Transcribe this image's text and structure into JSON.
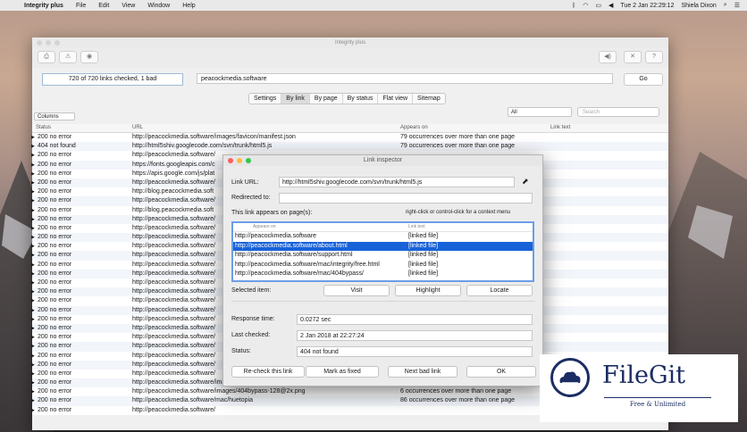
{
  "menubar": {
    "app_name": "Integrity plus",
    "items": [
      "File",
      "Edit",
      "View",
      "Window",
      "Help"
    ],
    "clock": "Tue 2 Jan  22:29:12",
    "user": "Shiela Dixon"
  },
  "window": {
    "title": "Integrity plus",
    "status": "720 of 720 links checked, 1 bad",
    "url": "peacockmedia.software",
    "go_label": "Go",
    "tabs": [
      "Settings",
      "By link",
      "By page",
      "By status",
      "Flat view",
      "Sitemap"
    ],
    "active_tab": "By link",
    "columns_select": "Columns",
    "filter_select": "All",
    "search_placeholder": "Search",
    "headers": {
      "status": "Status",
      "url": "URL",
      "appears": "Appears on",
      "linktext": "Link text"
    }
  },
  "rows": [
    {
      "status": "200 no error",
      "url": "http://peacockmedia.software/images/favicon/manifest.json",
      "appears": "79 occurrences over more than one page"
    },
    {
      "status": "404 not found",
      "url": "http://html5shiv.googlecode.com/svn/trunk/html5.js",
      "appears": "79 occurrences over more than one page"
    },
    {
      "status": "200 no error",
      "url": "http://peacockmedia.software/",
      "appears": ""
    },
    {
      "status": "200 no error",
      "url": "https://fonts.googleapis.com/c",
      "appears": ""
    },
    {
      "status": "200 no error",
      "url": "https://apis.google.com/js/plat",
      "appears": ""
    },
    {
      "status": "200 no error",
      "url": "http://peacockmedia.software/",
      "appears": ""
    },
    {
      "status": "200 no error",
      "url": "http://blog.peacockmedia.soft",
      "appears": ""
    },
    {
      "status": "200 no error",
      "url": "http://peacockmedia.software/",
      "appears": ""
    },
    {
      "status": "200 no error",
      "url": "http://blog.peacockmedia.soft",
      "appears": ""
    },
    {
      "status": "200 no error",
      "url": "http://peacockmedia.software/",
      "appears": ""
    },
    {
      "status": "200 no error",
      "url": "http://peacockmedia.software/",
      "appears": ""
    },
    {
      "status": "200 no error",
      "url": "http://peacockmedia.software/",
      "appears": ""
    },
    {
      "status": "200 no error",
      "url": "http://peacockmedia.software/",
      "appears": ""
    },
    {
      "status": "200 no error",
      "url": "http://peacockmedia.software/",
      "appears": ""
    },
    {
      "status": "200 no error",
      "url": "http://peacockmedia.software/",
      "appears": ""
    },
    {
      "status": "200 no error",
      "url": "http://peacockmedia.software/",
      "appears": ""
    },
    {
      "status": "200 no error",
      "url": "http://peacockmedia.software/",
      "appears": ""
    },
    {
      "status": "200 no error",
      "url": "http://peacockmedia.software/",
      "appears": ""
    },
    {
      "status": "200 no error",
      "url": "http://peacockmedia.software/",
      "appears": ""
    },
    {
      "status": "200 no error",
      "url": "http://peacockmedia.software/",
      "appears": ""
    },
    {
      "status": "200 no error",
      "url": "http://peacockmedia.software/",
      "appears": ""
    },
    {
      "status": "200 no error",
      "url": "http://peacockmedia.software/",
      "appears": ""
    },
    {
      "status": "200 no error",
      "url": "http://peacockmedia.software/",
      "appears": ""
    },
    {
      "status": "200 no error",
      "url": "http://peacockmedia.software/",
      "appears": ""
    },
    {
      "status": "200 no error",
      "url": "http://peacockmedia.software/",
      "appears": ""
    },
    {
      "status": "200 no error",
      "url": "http://peacockmedia.software/",
      "appears": ""
    },
    {
      "status": "200 no error",
      "url": "http://peacockmedia.software/",
      "appears": ""
    },
    {
      "status": "200 no error",
      "url": "http://peacockmedia.software/images/404bypass-128.png",
      "appears": "6 occurrences over more than one page"
    },
    {
      "status": "200 no error",
      "url": "http://peacockmedia.software/images/404bypass-128@2x.png",
      "appears": "6 occurrences over more than one page"
    },
    {
      "status": "200 no error",
      "url": "http://peacockmedia.software/mac/huetopia",
      "appears": "86 occurrences over more than one page"
    },
    {
      "status": "200 no error",
      "url": "http://peacockmedia.software/",
      "appears": ""
    }
  ],
  "inspector": {
    "title": "Link inspector",
    "link_url_label": "Link URL:",
    "link_url": "http://html5shiv.googlecode.com/svn/trunk/html5.js",
    "redirected_label": "Redirected to:",
    "redirected": "",
    "appears_label": "This link appears on page(s):",
    "hint": "right-click or control-click for a context menu",
    "list_headers": {
      "page": "Appears on",
      "text": "Link text"
    },
    "pages": [
      {
        "url": "http://peacockmedia.software",
        "text": "[linked file]"
      },
      {
        "url": "http://peacockmedia.software/about.html",
        "text": "[linked file]"
      },
      {
        "url": "http://peacockmedia.software/support.html",
        "text": "[linked file]"
      },
      {
        "url": "http://peacockmedia.software/mac/integrity/free.html",
        "text": "[linked file]"
      },
      {
        "url": "http://peacockmedia.software/mac/404bypass/",
        "text": "[linked file]"
      }
    ],
    "selected_item_label": "Selected item:",
    "visit": "Visit",
    "highlight": "Highlight",
    "locate": "Locate",
    "response_label": "Response time:",
    "response": "0.0272 sec",
    "checked_label": "Last checked:",
    "checked": "2 Jan 2018 at 22:27:24",
    "status_label": "Status:",
    "status": "404 not found",
    "recheck": "Re-check this link",
    "mark_fixed": "Mark as fixed",
    "next_bad": "Next bad link",
    "ok": "OK"
  },
  "watermark": {
    "name": "FileGit",
    "tagline": "Free & Unlimited"
  },
  "colors": {
    "selection": "#1862d8",
    "accent": "#1b2d63"
  }
}
